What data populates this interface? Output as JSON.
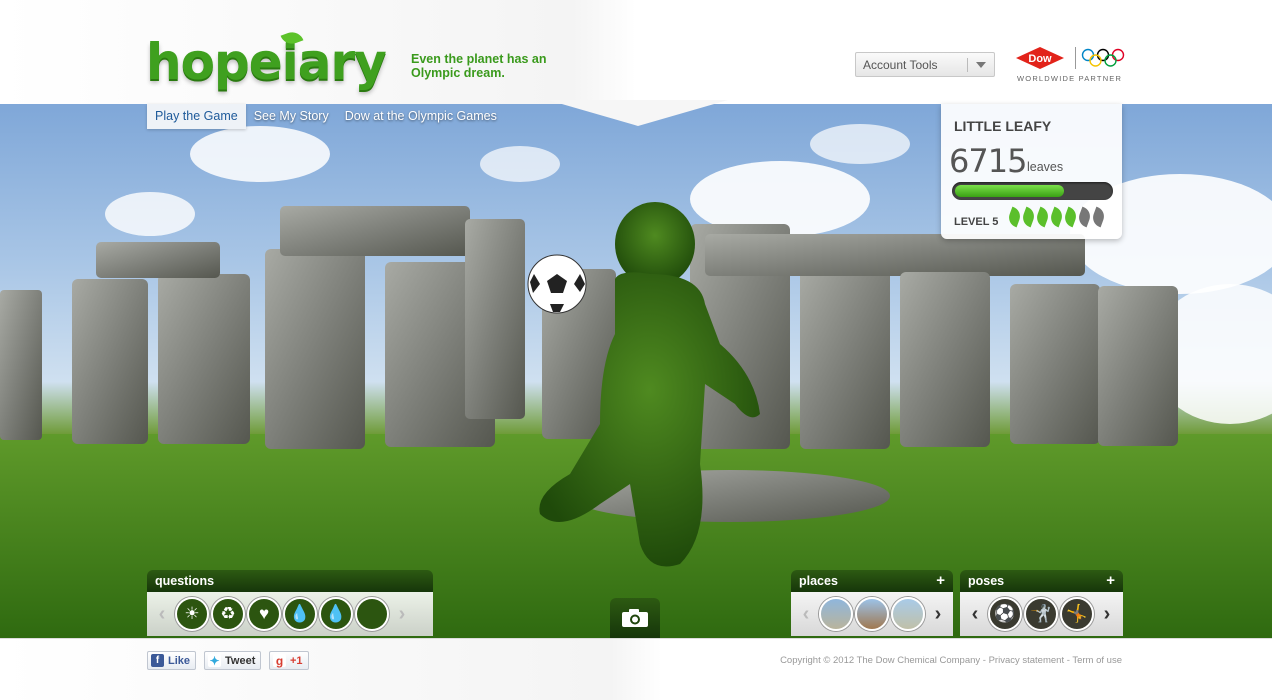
{
  "brand": {
    "logo_text": "hopeiary",
    "tagline": "Even the planet has an Olympic dream."
  },
  "header": {
    "account_tools_label": "Account Tools",
    "partner": {
      "dow_label": "Dow",
      "partner_text": "WORLDWIDE PARTNER"
    }
  },
  "nav": {
    "items": [
      {
        "label": "Play the Game",
        "active": true
      },
      {
        "label": "See My Story",
        "active": false
      },
      {
        "label": "Dow at the Olympic Games",
        "active": false
      }
    ]
  },
  "player": {
    "name": "LITTLE LEAFY",
    "leaves": "6715",
    "leaves_label": "leaves",
    "progress_fraction": 0.7,
    "level_label": "LEVEL 5",
    "level_leaves_total": 7,
    "level_leaves_filled": 5
  },
  "panels": {
    "questions": {
      "title": "questions",
      "icons": [
        "sun-icon",
        "recycle-leaf-icon",
        "heart-icon",
        "drop-icon",
        "drop-icon",
        "blank-icon"
      ]
    },
    "places": {
      "title": "places",
      "plus": "+",
      "thumbs": [
        "city-place-thumb",
        "pyramids-place-thumb",
        "building-place-thumb"
      ]
    },
    "poses": {
      "title": "poses",
      "plus": "+",
      "thumbs": [
        "soccer-pose-thumb",
        "fencing-pose-thumb",
        "gymnast-pose-thumb"
      ]
    }
  },
  "footer": {
    "like_label": "Like",
    "tweet_label": "Tweet",
    "plusone_label": "+1",
    "copyright": "Copyright © 2012 The Dow Chemical Company - Privacy statement - Term of use"
  },
  "colors": {
    "brand_green": "#3fa01f",
    "nav_active_text": "#1e5a9a",
    "panel_green": "#2d5a12"
  }
}
